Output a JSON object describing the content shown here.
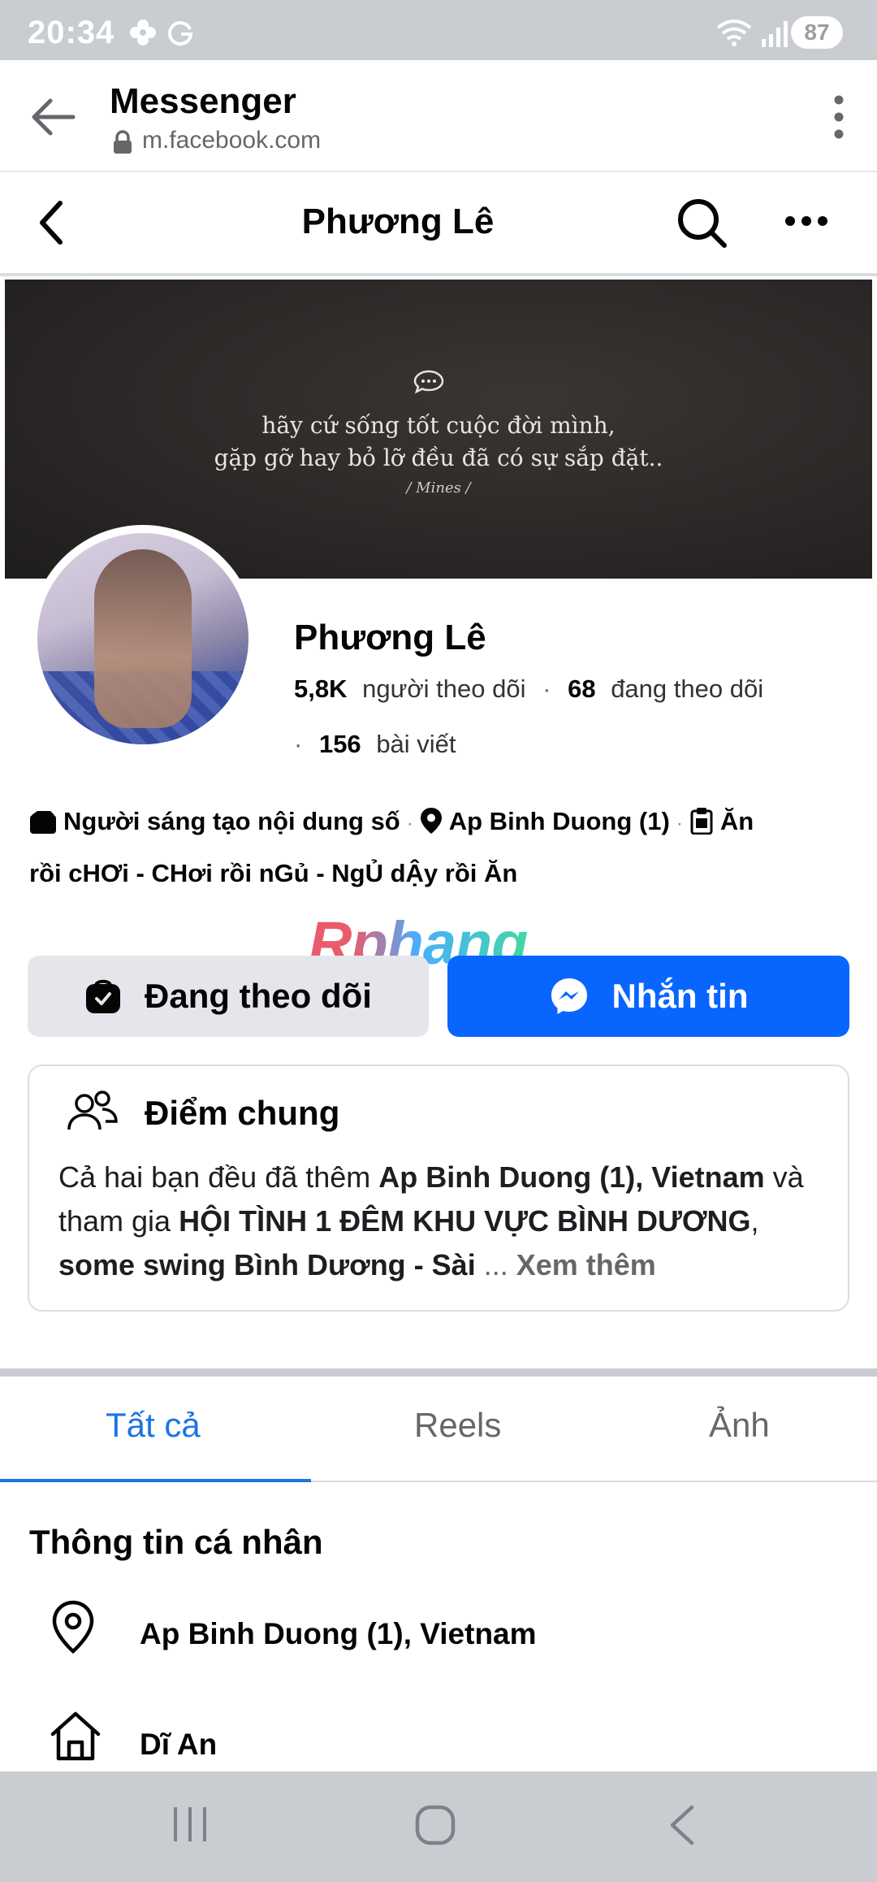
{
  "status_bar": {
    "time": "20:34",
    "battery": "87"
  },
  "browser": {
    "title": "Messenger",
    "url": "m.facebook.com"
  },
  "header": {
    "title": "Phương Lê"
  },
  "cover": {
    "quote_line1": "hãy cứ sống tốt cuộc đời mình,",
    "quote_line2": "gặp gỡ hay bỏ lỡ đều đã có sự sắp đặt..",
    "signature": "/ Mines /"
  },
  "profile": {
    "name": "Phương Lê",
    "followers_count": "5,8K",
    "followers_label": "người theo dõi",
    "following_count": "68",
    "following_label": "đang theo dõi",
    "posts_count": "156",
    "posts_label": "bài viết"
  },
  "bio": {
    "category": "Người sáng tạo nội dung số",
    "location": "Ap Binh Duong (1)",
    "intro_part1": "Ăn",
    "intro_part2": "rồi cHƠi - CHơi rồi nGủ - NgỦ dẬy rồi Ăn"
  },
  "watermark": "Rphang",
  "actions": {
    "following_label": "Đang theo dõi",
    "message_label": "Nhắn tin"
  },
  "common": {
    "title": "Điểm chung",
    "text_1": "Cả hai bạn đều đã thêm ",
    "text_location": "Ap Binh Duong (1), Vietnam",
    "text_2": " và tham gia ",
    "text_groups": "HỘI TÌNH 1 ĐÊM KHU VỰC BÌNH DƯƠNG",
    "text_3": ", ",
    "text_groups2": "some swing Bình Dương - Sài",
    "ellipsis": " ... ",
    "see_more": "Xem thêm"
  },
  "tabs": [
    {
      "label": "Tất cả",
      "active": true
    },
    {
      "label": "Reels",
      "active": false
    },
    {
      "label": "Ảnh",
      "active": false
    }
  ],
  "personal_info": {
    "title": "Thông tin cá nhân",
    "location": "Ap Binh Duong (1), Vietnam",
    "hometown": "Dĩ An"
  },
  "colors": {
    "primary_blue": "#0866ff",
    "tab_active": "#1b74e4",
    "button_grey": "#e4e6eb",
    "system_bar": "#c9ccd1"
  },
  "icons": {
    "browser_back": "arrow-left-icon",
    "lock": "lock-icon",
    "browser_menu": "vertical-dots-icon",
    "header_back": "chevron-left-icon",
    "search": "search-icon",
    "more": "horizontal-dots-icon",
    "category": "clapperboard-icon",
    "location": "map-pin-icon",
    "intro": "clipboard-icon",
    "following": "bag-check-icon",
    "messenger": "messenger-icon",
    "people": "people-icon",
    "home": "home-icon"
  }
}
